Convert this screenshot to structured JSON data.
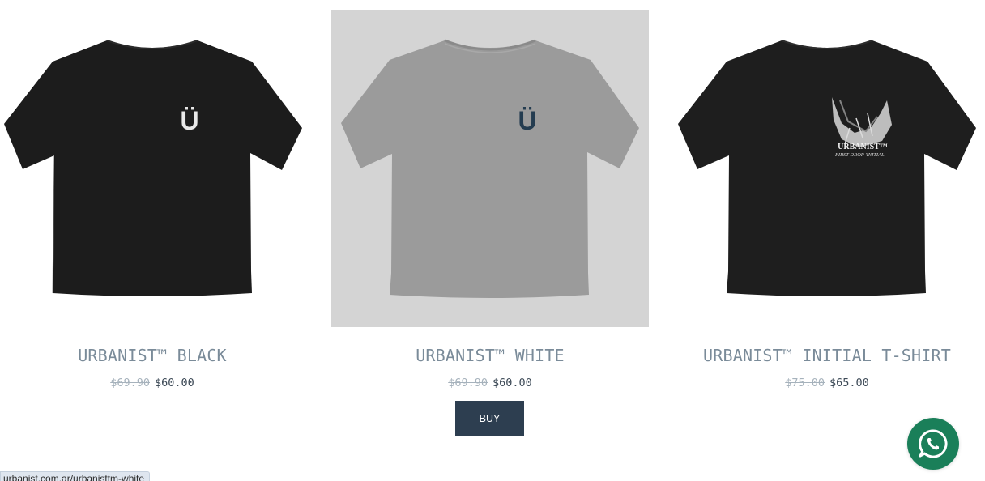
{
  "products": [
    {
      "title": "URBANIST™ BLACK",
      "old_price": "$69.90",
      "new_price": "$60.00",
      "shirt_color": "#1c1c1c",
      "logo_color": "#e8e8e8",
      "logo_text": "Ü"
    },
    {
      "title": "URBANIST™ WHITE",
      "old_price": "$69.90",
      "new_price": "$60.00",
      "shirt_color": "#9b9b9b",
      "logo_color": "#243c50",
      "logo_text": "Ü",
      "background": "#d4d4d4"
    },
    {
      "title": "URBANIST™ INITIAL T-SHIRT",
      "old_price": "$75.00",
      "new_price": "$65.00",
      "shirt_color": "#1e1e1e",
      "graphic_title": "URBANIST™",
      "graphic_subtitle": "FIRST DROP 'INITIAL'"
    }
  ],
  "buy_label": "BUY",
  "whatsapp": {
    "icon": "whatsapp-icon",
    "color": "#1a7f59"
  },
  "status_url": "urbanist.com.ar/urbanisttm-white"
}
